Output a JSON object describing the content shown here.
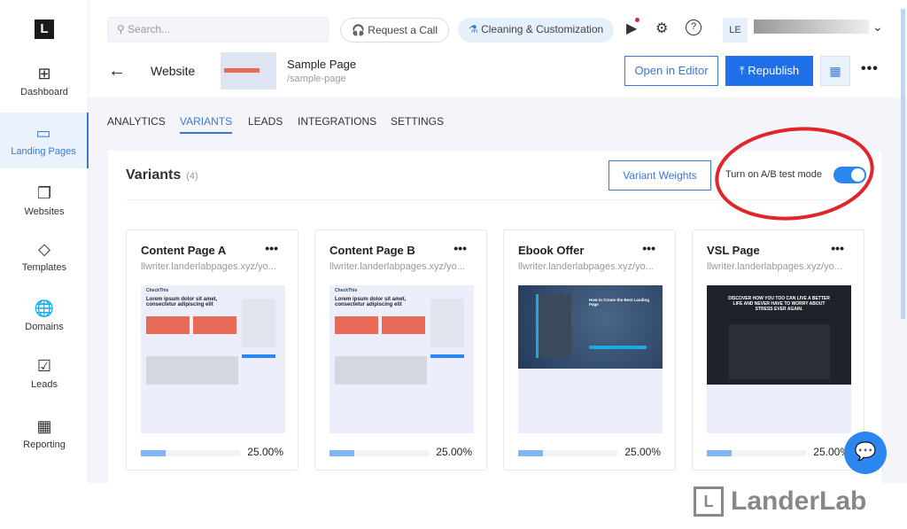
{
  "sidebar": {
    "items": [
      {
        "label": "Dashboard",
        "icon": "grid-icon",
        "glyph": "⊞"
      },
      {
        "label": "Landing Pages",
        "icon": "page-icon",
        "glyph": "▭",
        "active": true
      },
      {
        "label": "Websites",
        "icon": "stack-icon",
        "glyph": "❐"
      },
      {
        "label": "Templates",
        "icon": "templates-icon",
        "glyph": "◇"
      },
      {
        "label": "Domains",
        "icon": "globe-icon",
        "glyph": "🌐"
      },
      {
        "label": "Leads",
        "icon": "checklist-icon",
        "glyph": "☑"
      },
      {
        "label": "Reporting",
        "icon": "presentation-icon",
        "glyph": "▦"
      }
    ]
  },
  "header": {
    "search_placeholder": "Search...",
    "request_call": "Request a Call",
    "cleaning": "Cleaning & Customization",
    "avatar": "LE"
  },
  "page": {
    "breadcrumb": "Website",
    "title": "Sample Page",
    "slug": "/sample-page",
    "open_editor": "Open in Editor",
    "republish": "Republish"
  },
  "tabs": [
    {
      "label": "ANALYTICS"
    },
    {
      "label": "VARIANTS",
      "active": true
    },
    {
      "label": "LEADS"
    },
    {
      "label": "INTEGRATIONS"
    },
    {
      "label": "SETTINGS"
    }
  ],
  "variants": {
    "title": "Variants",
    "count": "(4)",
    "weights_button": "Variant Weights",
    "ab_label": "Turn on A/B test mode",
    "ab_enabled": true,
    "cards": [
      {
        "name": "Content Page A",
        "url": "llwriter.landerlabpages.xyz/yo...",
        "weight": 25,
        "weight_label": "25.00%"
      },
      {
        "name": "Content Page B",
        "url": "llwriter.landerlabpages.xyz/yo...",
        "weight": 25,
        "weight_label": "25.00%"
      },
      {
        "name": "Ebook Offer",
        "url": "llwriter.landerlabpages.xyz/yo...",
        "weight": 25,
        "weight_label": "25.00%"
      },
      {
        "name": "VSL Page",
        "url": "llwriter.landerlabpages.xyz/yo...",
        "weight": 25,
        "weight_label": "25.00%"
      }
    ]
  },
  "thumbs": {
    "content_heading": "Lorem ipsum dolor sit amet, consectetur adipiscing elit",
    "content_brand": "CheckThis",
    "ebook_heading": "How to Create the Best Landing Page",
    "vsl_heading": "DISCOVER HOW YOU TOO CAN LIVE A BETTER LIFE AND NEVER HAVE TO WORRY ABOUT STRESS EVER AGAIN."
  },
  "watermark": "LanderLab",
  "colors": {
    "accent": "#1f6fe8",
    "highlight_circle": "#e0262b",
    "toggle": "#2b86f0"
  }
}
